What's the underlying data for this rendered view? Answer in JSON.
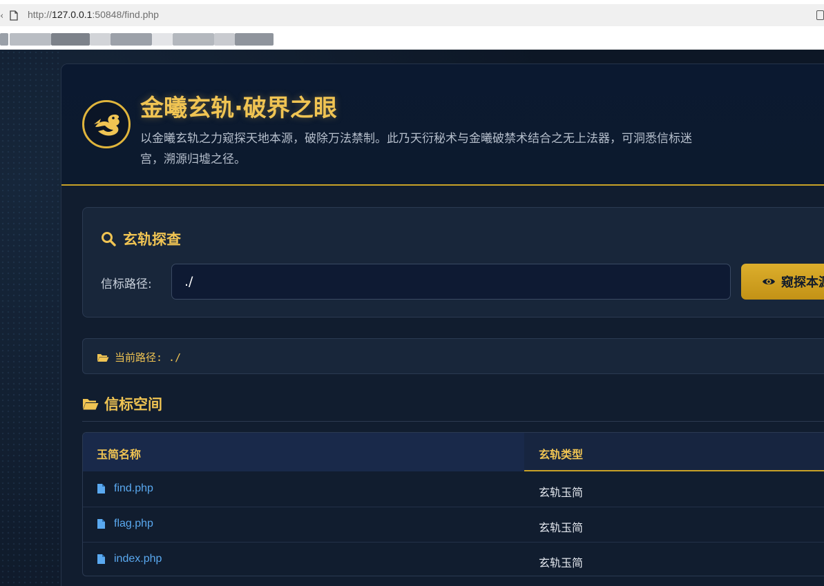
{
  "browser": {
    "url_prefix": "http://",
    "url_host": "127.0.0.1",
    "url_rest": ":50848/find.php"
  },
  "hero": {
    "title": "金曦玄轨·破界之眼",
    "description": "以金曦玄轨之力窥探天地本源，破除万法禁制。此乃天衍秘术与金曦破禁术结合之无上法器，可洞悉信标迷宫，溯源归墟之径。"
  },
  "search": {
    "heading": "玄轨探查",
    "field_label": "信标路径:",
    "path_value": "./",
    "button_label": "窥探本源"
  },
  "current_path": {
    "text": "当前路径: ./"
  },
  "listing": {
    "title": "信标空间",
    "columns": [
      "玉简名称",
      "玄轨类型"
    ],
    "rows": [
      {
        "name": "find.php",
        "type": "玄轨玉简"
      },
      {
        "name": "flag.php",
        "type": "玄轨玉简"
      },
      {
        "name": "index.php",
        "type": "玄轨玉简"
      }
    ]
  },
  "colors": {
    "accent_gold": "#f0c453",
    "link_blue": "#5aa9f0",
    "panel_bg": "#111d2f"
  }
}
